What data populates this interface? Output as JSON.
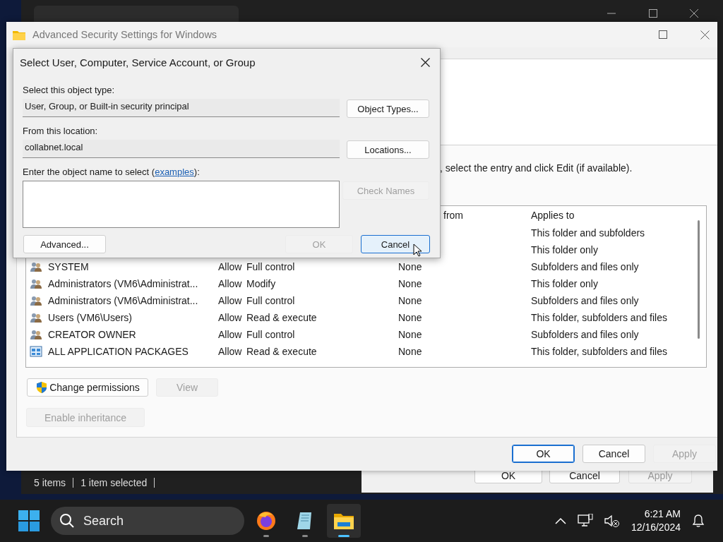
{
  "explorer_window": {
    "status_bar": {
      "item_count": "5 items",
      "selection": "1 item selected"
    }
  },
  "properties_window": {
    "buttons": [
      {
        "label": "OK",
        "disabled": false
      },
      {
        "label": "Cancel",
        "disabled": false
      },
      {
        "label": "Apply",
        "disabled": true
      }
    ]
  },
  "security_window": {
    "title": "Advanced Security Settings for Windows",
    "instruction": ", select the entry and click Edit (if available).",
    "table": {
      "headers": {
        "inherited_from": "from",
        "applies_to": "Applies to"
      },
      "rows": [
        {
          "applies_to": "This folder and subfolders"
        },
        {
          "applies_to": "This folder only"
        },
        {
          "kind": "group",
          "principal": "SYSTEM",
          "type": "Allow",
          "access": "Full control",
          "inherited_from": "None",
          "applies_to": "Subfolders and files only"
        },
        {
          "kind": "group",
          "principal": "Administrators (VM6\\Administrat...",
          "type": "Allow",
          "access": "Modify",
          "inherited_from": "None",
          "applies_to": "This folder only"
        },
        {
          "kind": "group",
          "principal": "Administrators (VM6\\Administrat...",
          "type": "Allow",
          "access": "Full control",
          "inherited_from": "None",
          "applies_to": "Subfolders and files only"
        },
        {
          "kind": "group",
          "principal": "Users (VM6\\Users)",
          "type": "Allow",
          "access": "Read & execute",
          "inherited_from": "None",
          "applies_to": "This folder, subfolders and files"
        },
        {
          "kind": "group",
          "principal": "CREATOR OWNER",
          "type": "Allow",
          "access": "Full control",
          "inherited_from": "None",
          "applies_to": "Subfolders and files only"
        },
        {
          "kind": "package",
          "principal": "ALL APPLICATION PACKAGES",
          "type": "Allow",
          "access": "Read & execute",
          "inherited_from": "None",
          "applies_to": "This folder, subfolders and files"
        }
      ]
    },
    "actions": [
      {
        "label": "Change permissions",
        "kind": "shield",
        "disabled": false
      },
      {
        "label": "View",
        "kind": "plain",
        "disabled": true
      }
    ],
    "inheritance_button": {
      "label": "Enable inheritance",
      "disabled": true
    },
    "footer_buttons": [
      {
        "label": "OK",
        "default": true,
        "disabled": false
      },
      {
        "label": "Cancel",
        "default": false,
        "disabled": false
      },
      {
        "label": "Apply",
        "default": false,
        "disabled": true
      }
    ]
  },
  "select_dialog": {
    "title": "Select User, Computer, Service Account, or Group",
    "object_type": {
      "label": "Select this object type:",
      "value": "User, Group, or Built-in security principal",
      "button": "Object Types..."
    },
    "location": {
      "label": "From this location:",
      "value": "collabnet.local",
      "button": "Locations..."
    },
    "object_name": {
      "label_before": "Enter the object name to select (",
      "link": "examples",
      "label_after": "):",
      "check_button": {
        "label": "Check Names",
        "disabled": true
      }
    },
    "buttons": [
      {
        "label": "Advanced...",
        "kind": "left",
        "disabled": false,
        "focused": false
      },
      {
        "label": "OK",
        "kind": "right",
        "disabled": true,
        "focused": false
      },
      {
        "label": "Cancel",
        "kind": "right",
        "disabled": false,
        "focused": true
      }
    ]
  },
  "taskbar": {
    "search": {
      "placeholder": "Search"
    },
    "apps": [
      {
        "kind": "firefox",
        "active": false
      },
      {
        "kind": "notepad",
        "active": false
      },
      {
        "kind": "explorer",
        "active": true
      }
    ],
    "clock": {
      "time": "6:21 AM",
      "date": "12/16/2024"
    }
  }
}
